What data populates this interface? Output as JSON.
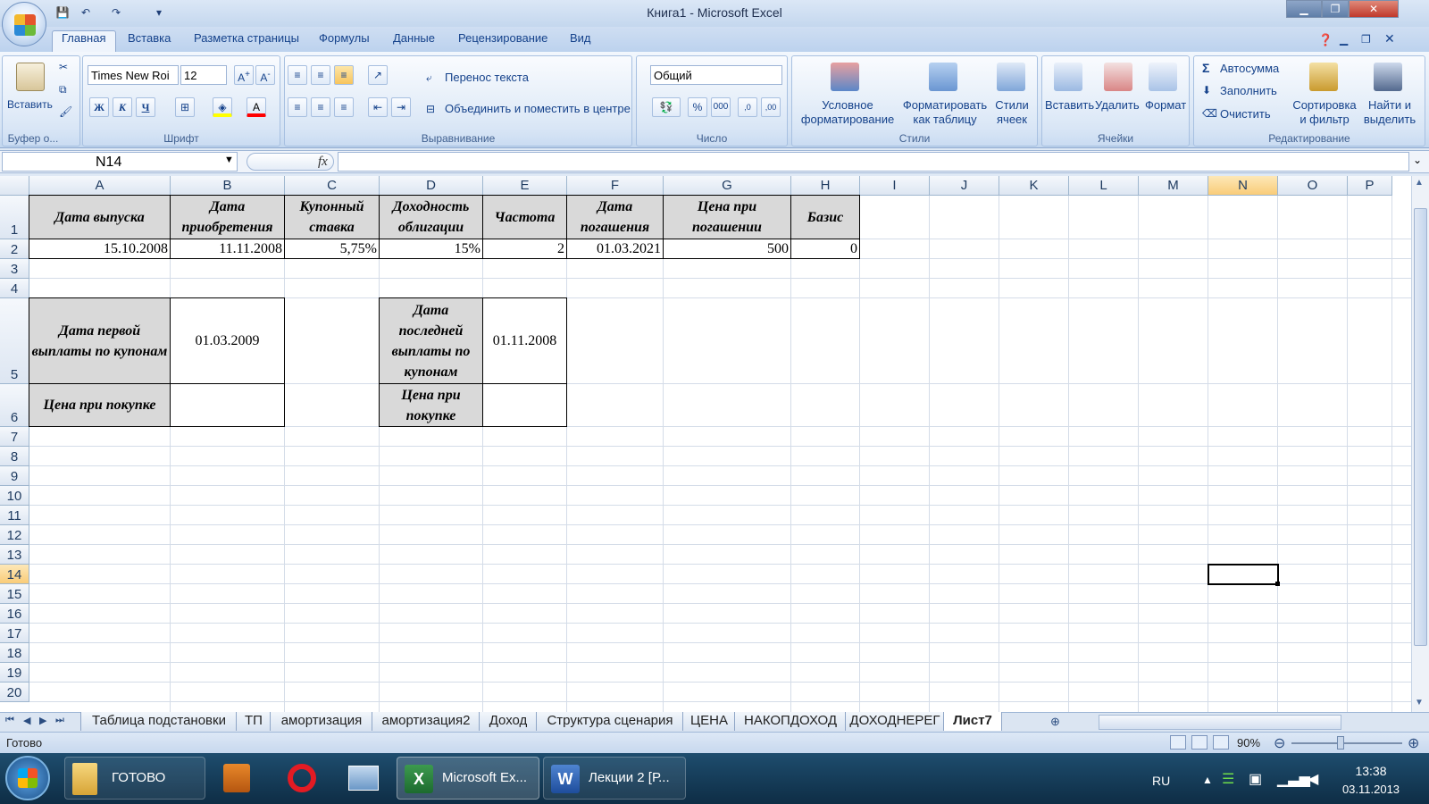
{
  "window": {
    "title": "Книга1 - Microsoft Excel"
  },
  "tabs": [
    "Главная",
    "Вставка",
    "Разметка страницы",
    "Формулы",
    "Данные",
    "Рецензирование",
    "Вид"
  ],
  "ribbon": {
    "clipboard": {
      "paste": "Вставить",
      "label": "Буфер о..."
    },
    "font": {
      "name": "Times New Roi",
      "size": "12",
      "label": "Шрифт",
      "bold": "Ж",
      "italic": "К",
      "underline": "Ч"
    },
    "alignment": {
      "wrap": "Перенос текста",
      "merge": "Объединить и поместить в центре",
      "label": "Выравнивание"
    },
    "number": {
      "format": "Общий",
      "percent": "%",
      "thousands": "000",
      "label": "Число"
    },
    "styles": {
      "conditional": [
        "Условное",
        "форматирование"
      ],
      "table": [
        "Форматировать",
        "как таблицу"
      ],
      "cell": [
        "Стили",
        "ячеек"
      ],
      "label": "Стили"
    },
    "cells": {
      "insert": "Вставить",
      "delete": "Удалить",
      "format": "Формат",
      "label": "Ячейки"
    },
    "editing": {
      "autosum": "Автосумма",
      "fill": "Заполнить",
      "clear": "Очистить",
      "sort": [
        "Сортировка",
        "и фильтр"
      ],
      "find": [
        "Найти и",
        "выделить"
      ],
      "label": "Редактирование"
    }
  },
  "formula_bar": {
    "name_box": "N14",
    "fx": "fx",
    "content": ""
  },
  "columns": [
    "A",
    "B",
    "C",
    "D",
    "E",
    "F",
    "G",
    "H",
    "I",
    "J",
    "K",
    "L",
    "M",
    "N",
    "O",
    "P"
  ],
  "rows": [
    "1",
    "2",
    "3",
    "4",
    "5",
    "6",
    "7",
    "8",
    "9",
    "10",
    "11",
    "12",
    "13",
    "14",
    "15",
    "16",
    "17",
    "18",
    "19",
    "20"
  ],
  "selected": {
    "column": "N",
    "row": "14"
  },
  "sheet": {
    "headers": [
      "Дата выпуска",
      "Дата приобретения",
      "Купонный ставка",
      "Доходность облигации",
      "Частота",
      "Дата погашения",
      "Цена при погашении",
      "Базис"
    ],
    "values": [
      "15.10.2008",
      "11.11.2008",
      "5,75%",
      "15%",
      "2",
      "01.03.2021",
      "500",
      "0"
    ],
    "first_coupon_label": "Дата первой выплаты по купонам",
    "first_coupon_value": "01.03.2009",
    "last_coupon_label": "Дата последней выплаты по купонам",
    "last_coupon_value": "01.11.2008",
    "price_label_1": "Цена при покупке",
    "price_label_2": "Цена при покупке"
  },
  "sheet_tabs": [
    "Таблица подстановки",
    "ТП",
    "амортизация",
    "амортизация2",
    "Доход",
    "Структура сценария",
    "ЦЕНА",
    "НАКОПДОХОД",
    "ДОХОДНЕРЕГ",
    "Лист7"
  ],
  "active_sheet": "Лист7",
  "status": {
    "ready": "Готово",
    "zoom": "90%"
  },
  "taskbar": {
    "folder": "ГОТОВО",
    "excel": "Microsoft Ex...",
    "word": "Лекции 2 [Р...",
    "lang": "RU",
    "time": "13:38",
    "date": "03.11.2013"
  }
}
